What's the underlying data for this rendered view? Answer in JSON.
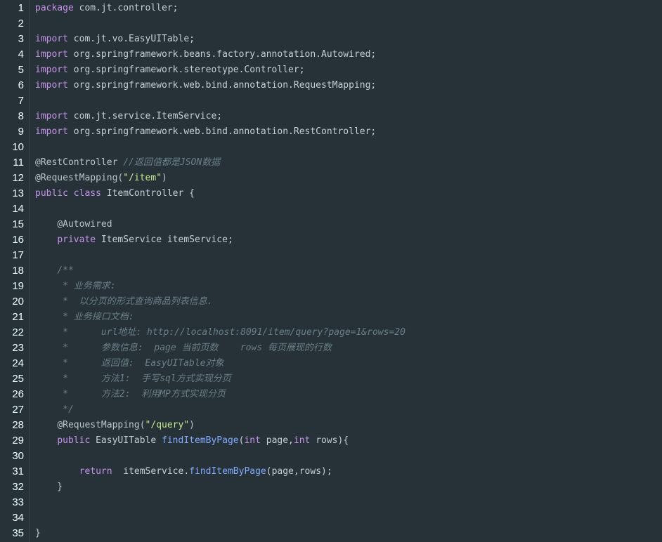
{
  "colors": {
    "background": "#263238",
    "keyword": "#c792ea",
    "string": "#c3e88d",
    "function": "#82aaff",
    "comment": "#6b7f88",
    "text": "#c5cfd4"
  },
  "line_numbers": [
    "1",
    "2",
    "3",
    "4",
    "5",
    "6",
    "7",
    "8",
    "9",
    "10",
    "11",
    "12",
    "13",
    "14",
    "15",
    "16",
    "17",
    "18",
    "19",
    "20",
    "21",
    "22",
    "23",
    "24",
    "25",
    "26",
    "27",
    "28",
    "29",
    "30",
    "31",
    "32",
    "33",
    "34",
    "35"
  ],
  "lines": [
    [
      [
        "kw",
        "package"
      ],
      [
        "plain",
        " com.jt.controller;"
      ]
    ],
    [],
    [
      [
        "kw",
        "import"
      ],
      [
        "plain",
        " com.jt.vo.EasyUITable;"
      ]
    ],
    [
      [
        "kw",
        "import"
      ],
      [
        "plain",
        " org.springframework.beans.factory.annotation.Autowired;"
      ]
    ],
    [
      [
        "kw",
        "import"
      ],
      [
        "plain",
        " org.springframework.stereotype.Controller;"
      ]
    ],
    [
      [
        "kw",
        "import"
      ],
      [
        "plain",
        " org.springframework.web.bind.annotation.RequestMapping;"
      ]
    ],
    [],
    [
      [
        "kw",
        "import"
      ],
      [
        "plain",
        " com.jt.service.ItemService;"
      ]
    ],
    [
      [
        "kw",
        "import"
      ],
      [
        "plain",
        " org.springframework.web.bind.annotation.RestController;"
      ]
    ],
    [],
    [
      [
        "ann",
        "@RestController"
      ],
      [
        "plain",
        " "
      ],
      [
        "cm",
        "//返回值都是JSON数据"
      ]
    ],
    [
      [
        "ann",
        "@RequestMapping("
      ],
      [
        "str",
        "\"/item\""
      ],
      [
        "ann",
        ")"
      ]
    ],
    [
      [
        "kw",
        "public"
      ],
      [
        "plain",
        " "
      ],
      [
        "kw",
        "class"
      ],
      [
        "plain",
        " ItemController {"
      ]
    ],
    [],
    [
      [
        "plain",
        "    "
      ],
      [
        "ann",
        "@Autowired"
      ]
    ],
    [
      [
        "plain",
        "    "
      ],
      [
        "kw",
        "private"
      ],
      [
        "plain",
        " ItemService itemService;"
      ]
    ],
    [],
    [
      [
        "plain",
        "    "
      ],
      [
        "cm",
        "/**"
      ]
    ],
    [
      [
        "cm",
        "     * 业务需求:"
      ]
    ],
    [
      [
        "cm",
        "     *  以分页的形式查询商品列表信息."
      ]
    ],
    [
      [
        "cm",
        "     * 业务接口文档:"
      ]
    ],
    [
      [
        "cm",
        "     *      url地址: http://localhost:8091/item/query?page=1&rows=20"
      ]
    ],
    [
      [
        "cm",
        "     *      参数信息:  page 当前页数    rows 每页展现的行数"
      ]
    ],
    [
      [
        "cm",
        "     *      返回值:  EasyUITable对象"
      ]
    ],
    [
      [
        "cm",
        "     *      方法1:  手写sql方式实现分页"
      ]
    ],
    [
      [
        "cm",
        "     *      方法2:  利用MP方式实现分页"
      ]
    ],
    [
      [
        "cm",
        "     */"
      ]
    ],
    [
      [
        "plain",
        "    "
      ],
      [
        "ann",
        "@RequestMapping("
      ],
      [
        "str",
        "\"/query\""
      ],
      [
        "ann",
        ")"
      ]
    ],
    [
      [
        "plain",
        "    "
      ],
      [
        "kw",
        "public"
      ],
      [
        "plain",
        " EasyUITable "
      ],
      [
        "fn",
        "findItemByPage"
      ],
      [
        "plain",
        "("
      ],
      [
        "kw",
        "int"
      ],
      [
        "plain",
        " page,"
      ],
      [
        "kw",
        "int"
      ],
      [
        "plain",
        " rows){"
      ]
    ],
    [],
    [
      [
        "plain",
        "        "
      ],
      [
        "kw",
        "return"
      ],
      [
        "plain",
        "  itemService."
      ],
      [
        "fn",
        "findItemByPage"
      ],
      [
        "plain",
        "(page,rows);"
      ]
    ],
    [
      [
        "plain",
        "    }"
      ]
    ],
    [],
    [],
    [
      [
        "plain",
        "}"
      ]
    ]
  ]
}
